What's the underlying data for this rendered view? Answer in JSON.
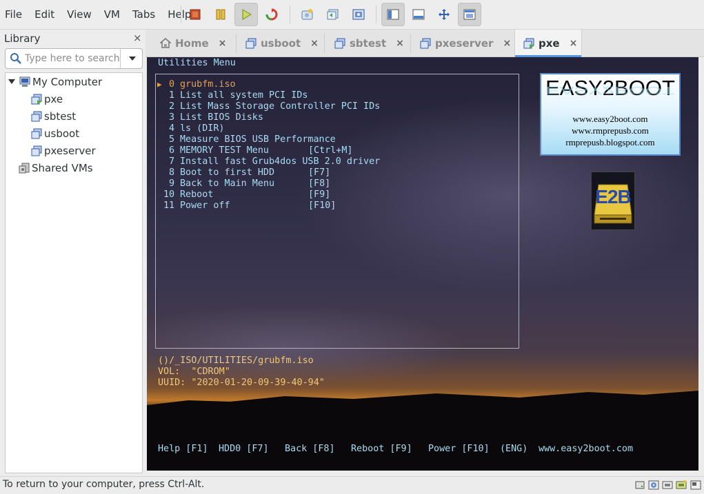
{
  "menubar": {
    "items": [
      "File",
      "Edit",
      "View",
      "VM",
      "Tabs",
      "Help"
    ]
  },
  "toolbar": {
    "buttons": [
      "power-off-icon",
      "suspend-icon",
      "power-on-icon",
      "reset-icon",
      "snapshot-icon",
      "revert-snapshot-icon",
      "manage-snapshots-icon",
      "show-library-icon",
      "show-thumbnail-bar-icon",
      "full-screen-icon",
      "unity-icon"
    ]
  },
  "library": {
    "title": "Library",
    "close": "×",
    "search_placeholder": "Type here to search",
    "tree": {
      "root": "My Computer",
      "vms": [
        "pxe",
        "sbtest",
        "usboot",
        "pxeserver"
      ],
      "shared": "Shared VMs"
    }
  },
  "tabs": [
    {
      "label": "Home",
      "icon": "home-icon",
      "selected": false
    },
    {
      "label": "usboot",
      "icon": "vm-icon",
      "selected": false
    },
    {
      "label": "sbtest",
      "icon": "vm-icon",
      "selected": false
    },
    {
      "label": "pxeserver",
      "icon": "vm-icon",
      "selected": false
    },
    {
      "label": "pxe",
      "icon": "vm-running-icon",
      "selected": true
    }
  ],
  "tab_close": "×",
  "console": {
    "title": "Utilities Menu",
    "selector": "▶",
    "menu": [
      {
        "num": "0",
        "label": "grubfm.iso",
        "key": ""
      },
      {
        "num": "1",
        "label": "List all system PCI IDs",
        "key": ""
      },
      {
        "num": "2",
        "label": "List Mass Storage Controller PCI IDs",
        "key": ""
      },
      {
        "num": "3",
        "label": "List BIOS Disks",
        "key": ""
      },
      {
        "num": "4",
        "label": "ls (DIR)",
        "key": ""
      },
      {
        "num": "5",
        "label": "Measure BIOS USB Performance",
        "key": ""
      },
      {
        "num": "6",
        "label": "MEMORY TEST Menu",
        "key": "[Ctrl+M]"
      },
      {
        "num": "7",
        "label": "Install fast Grub4dos USB 2.0 driver",
        "key": ""
      },
      {
        "num": "8",
        "label": "Boot to first HDD",
        "key": "[F7]"
      },
      {
        "num": "9",
        "label": "Back to Main Menu",
        "key": "[F8]"
      },
      {
        "num": "10",
        "label": "Reboot",
        "key": "[F9]"
      },
      {
        "num": "11",
        "label": "Power off",
        "key": "[F10]"
      }
    ],
    "info": {
      "path": "()/_ISO/UTILITIES/grubfm.iso",
      "vol": "VOL:  \"CDROM\"",
      "uuid": "UUID: \"2020-01-20-09-39-40-94\""
    },
    "footer": [
      "Help [F1]",
      "HDD0 [F7]",
      "Back [F8]",
      "Reboot [F9]",
      "Power [F10]",
      "(ENG)",
      "www.easy2boot.com"
    ],
    "logo": {
      "title": "EASY2BOOT",
      "lines": [
        "www.easy2boot.com",
        "www.rmprepusb.com",
        "rmprepusb.blogspot.com"
      ],
      "badge": "E2B"
    },
    "colors": {
      "text": "#a8dcf2",
      "selected": "#e8a048",
      "info": "#f0c878"
    }
  },
  "status": {
    "message": "To return to your computer, press Ctrl-Alt.",
    "icons": [
      "hard-disk-icon",
      "cd-rom-icon",
      "network-icon",
      "usb-icon",
      "message-icon"
    ]
  }
}
